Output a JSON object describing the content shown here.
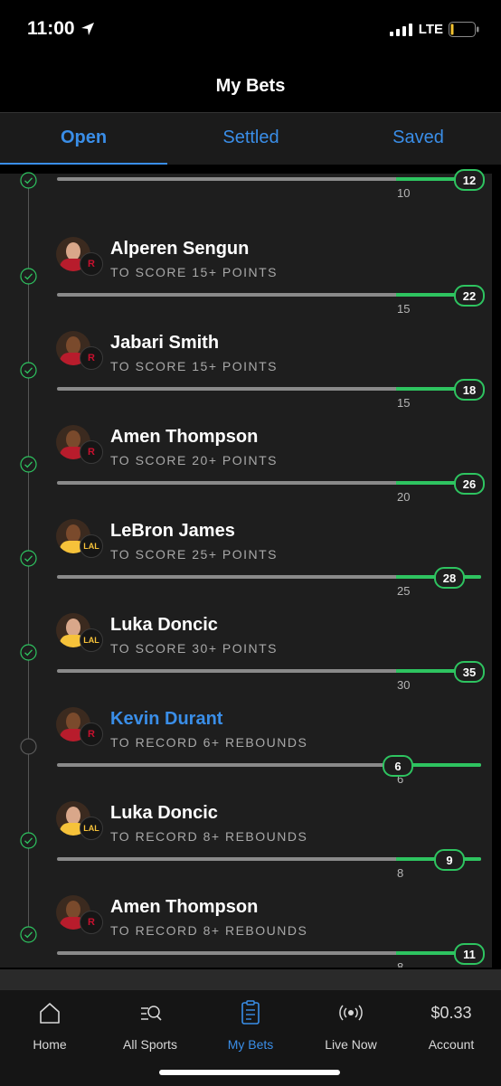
{
  "status_bar": {
    "time": "11:00",
    "network": "LTE"
  },
  "header": {
    "title": "My Bets"
  },
  "tabs": [
    {
      "label": "Open",
      "active": true
    },
    {
      "label": "Settled",
      "active": false
    },
    {
      "label": "Saved",
      "active": false
    }
  ],
  "legs": [
    {
      "player": "",
      "market": "",
      "target": "10",
      "value": "12",
      "progress": 1.0,
      "status": "won",
      "team": "HOU"
    },
    {
      "player": "Alperen Sengun",
      "market": "TO SCORE 15+ POINTS",
      "target": "15",
      "value": "22",
      "progress": 1.0,
      "status": "won",
      "team": "HOU"
    },
    {
      "player": "Jabari Smith",
      "market": "TO SCORE 15+ POINTS",
      "target": "15",
      "value": "18",
      "progress": 1.0,
      "status": "won",
      "team": "HOU"
    },
    {
      "player": "Amen Thompson",
      "market": "TO SCORE 20+ POINTS",
      "target": "20",
      "value": "26",
      "progress": 1.0,
      "status": "won",
      "team": "HOU"
    },
    {
      "player": "LeBron James",
      "market": "TO SCORE 25+ POINTS",
      "target": "25",
      "value": "28",
      "progress": 1.0,
      "status": "won",
      "team": "LAL"
    },
    {
      "player": "Luka Doncic",
      "market": "TO SCORE 30+ POINTS",
      "target": "30",
      "value": "35",
      "progress": 1.0,
      "status": "won",
      "team": "LAL"
    },
    {
      "player": "Kevin Durant",
      "market": "TO RECORD 6+ REBOUNDS",
      "target": "6",
      "value": "6",
      "progress": 1.0,
      "status": "pending",
      "team": "HOU"
    },
    {
      "player": "Luka Doncic",
      "market": "TO RECORD 8+ REBOUNDS",
      "target": "8",
      "value": "9",
      "progress": 1.0,
      "status": "won",
      "team": "LAL"
    },
    {
      "player": "Amen Thompson",
      "market": "TO RECORD 8+ REBOUNDS",
      "target": "8",
      "value": "11",
      "progress": 1.0,
      "status": "won",
      "team": "HOU"
    }
  ],
  "nav": [
    {
      "label": "Home",
      "icon": "home-icon"
    },
    {
      "label": "All Sports",
      "icon": "sports-search-icon"
    },
    {
      "label": "My Bets",
      "icon": "bet-slip-icon",
      "active": true
    },
    {
      "label": "Live Now",
      "icon": "live-broadcast-icon"
    },
    {
      "label": "Account",
      "value": "$0.33"
    }
  ],
  "colors": {
    "accent": "#3a8ee8",
    "success": "#2ec460",
    "card": "#1e1e1e"
  }
}
